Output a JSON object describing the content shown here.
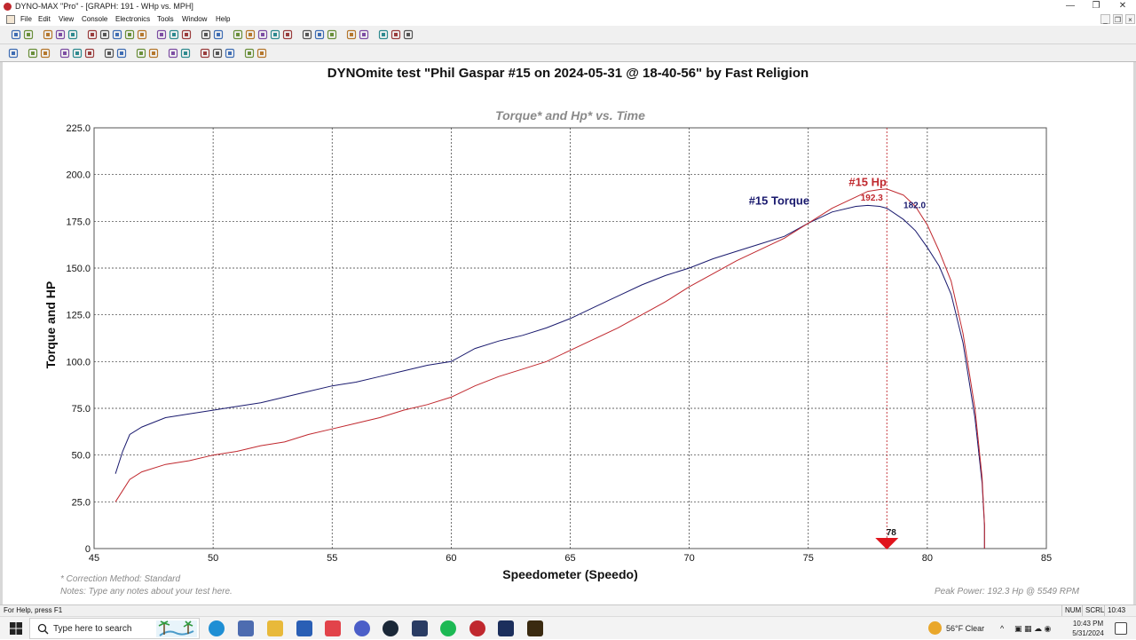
{
  "window": {
    "title": "DYNO-MAX \"Pro\" - [GRAPH: 191 - WHp vs. MPH]",
    "controls": {
      "minimize": "—",
      "maximize": "❐",
      "close": "✕"
    },
    "mdi_controls": {
      "minimize": "_",
      "restore": "❐",
      "close": "×"
    }
  },
  "menu": {
    "items": [
      "File",
      "Edit",
      "View",
      "Console",
      "Electronics",
      "Tools",
      "Window",
      "Help"
    ]
  },
  "toolbar1": {
    "icons": [
      "new-icon",
      "open-icon",
      "save-icon",
      "config-icon",
      "tree-icon",
      "binoculars-icon",
      "copy-icon",
      "paste-icon",
      "print-preview-icon",
      "print-icon",
      "page-setup-icon",
      "import-icon",
      "help-icon",
      "whats-this-icon",
      "grid-icon",
      "tools-icon",
      "table-icon",
      "graph-refresh-icon",
      "table-view-icon",
      "spreadsheet-icon",
      "scale-icon",
      "wave-icon",
      "chart-icon",
      "options-icon",
      "hammer-icon",
      "balloon-icon",
      "settings-icon",
      "gear-icon"
    ]
  },
  "toolbar2": {
    "icons": [
      "pan-icon",
      "cursor-down-icon",
      "cursor-line-icon",
      "zoom-box-icon",
      "zoom-icon",
      "hand-icon",
      "scale-up-icon",
      "scale-down-icon",
      "smooth-icon",
      "overlay-icon",
      "prev-run-icon",
      "next-run-icon",
      "legend-icon",
      "font-icon",
      "color-icon",
      "export-icon",
      "print-graph-icon"
    ]
  },
  "chart_data": {
    "type": "line",
    "title": "DYNOmite test \"Phil Gaspar #15 on 2024-05-31 @ 18-40-56\" by Fast Religion",
    "subtitle": "Torque* and Hp* vs. Time",
    "xlabel": "Speedometer (Speedo)",
    "ylabel": "Torque and HP",
    "xlim": [
      45,
      85
    ],
    "ylim": [
      0,
      225
    ],
    "x_ticks": [
      "45",
      "50",
      "55",
      "60",
      "65",
      "70",
      "75",
      "80",
      "85"
    ],
    "y_ticks": [
      "0",
      "25.0",
      "50.0",
      "75.0",
      "100.0",
      "125.0",
      "150.0",
      "175.0",
      "200.0",
      "225.0"
    ],
    "grid": true,
    "series": [
      {
        "name": "#15 Torque",
        "color": "#1a1a6e",
        "peak_label": "182.0",
        "points": [
          [
            45.9,
            40
          ],
          [
            46.2,
            52
          ],
          [
            46.5,
            61
          ],
          [
            47.0,
            65
          ],
          [
            48.0,
            70
          ],
          [
            49.0,
            72
          ],
          [
            50.0,
            74
          ],
          [
            51.0,
            76
          ],
          [
            52.0,
            78
          ],
          [
            53.0,
            81
          ],
          [
            54.0,
            84
          ],
          [
            55.0,
            87
          ],
          [
            56.0,
            89
          ],
          [
            57.0,
            92
          ],
          [
            58.0,
            95
          ],
          [
            59.0,
            98
          ],
          [
            60.0,
            100
          ],
          [
            61.0,
            107
          ],
          [
            62.0,
            111
          ],
          [
            63.0,
            114
          ],
          [
            64.0,
            118
          ],
          [
            65.0,
            123
          ],
          [
            66.0,
            129
          ],
          [
            67.0,
            135
          ],
          [
            68.0,
            141
          ],
          [
            69.0,
            146
          ],
          [
            70.0,
            150
          ],
          [
            71.0,
            155
          ],
          [
            72.0,
            159
          ],
          [
            73.0,
            163
          ],
          [
            74.0,
            167
          ],
          [
            75.0,
            174
          ],
          [
            76.0,
            180
          ],
          [
            77.0,
            183
          ],
          [
            77.5,
            183.5
          ],
          [
            78.0,
            183
          ],
          [
            78.3,
            182
          ],
          [
            79.0,
            176
          ],
          [
            79.5,
            170
          ],
          [
            80.0,
            161
          ],
          [
            80.5,
            151
          ],
          [
            81.0,
            136
          ],
          [
            81.5,
            110
          ],
          [
            82.0,
            70
          ],
          [
            82.3,
            35
          ],
          [
            82.4,
            12
          ],
          [
            82.4,
            0
          ]
        ]
      },
      {
        "name": "#15 Hp",
        "color": "#c0282e",
        "peak_label": "192.3",
        "points": [
          [
            45.9,
            25
          ],
          [
            46.2,
            31
          ],
          [
            46.5,
            37
          ],
          [
            47.0,
            41
          ],
          [
            48.0,
            45
          ],
          [
            49.0,
            47
          ],
          [
            50.0,
            50
          ],
          [
            51.0,
            52
          ],
          [
            52.0,
            55
          ],
          [
            53.0,
            57
          ],
          [
            54.0,
            61
          ],
          [
            55.0,
            64
          ],
          [
            56.0,
            67
          ],
          [
            57.0,
            70
          ],
          [
            58.0,
            74
          ],
          [
            59.0,
            77
          ],
          [
            60.0,
            81
          ],
          [
            61.0,
            87
          ],
          [
            62.0,
            92
          ],
          [
            63.0,
            96
          ],
          [
            64.0,
            100
          ],
          [
            65.0,
            106
          ],
          [
            66.0,
            112
          ],
          [
            67.0,
            118
          ],
          [
            68.0,
            125
          ],
          [
            69.0,
            132
          ],
          [
            70.0,
            140
          ],
          [
            71.0,
            147
          ],
          [
            72.0,
            154
          ],
          [
            73.0,
            160
          ],
          [
            74.0,
            166
          ],
          [
            75.0,
            174
          ],
          [
            76.0,
            182
          ],
          [
            77.0,
            188
          ],
          [
            77.5,
            191
          ],
          [
            78.0,
            192
          ],
          [
            78.3,
            192.3
          ],
          [
            79.0,
            189
          ],
          [
            79.5,
            183
          ],
          [
            80.0,
            173
          ],
          [
            80.5,
            159
          ],
          [
            81.0,
            143
          ],
          [
            81.5,
            115
          ],
          [
            82.0,
            75
          ],
          [
            82.3,
            38
          ],
          [
            82.4,
            13
          ],
          [
            82.4,
            0
          ]
        ]
      }
    ],
    "cursor": {
      "x": 78.3,
      "label": "78"
    }
  },
  "footer": {
    "correction": "* Correction Method: Standard",
    "notes": "Notes: Type any notes about your test here.",
    "peak_power": "Peak Power: 192.3 Hp @ 5549 RPM"
  },
  "statusbar": {
    "help": "For Help, press F1",
    "num": "NUM",
    "scrl": "SCRL",
    "time": "10:43 PM"
  },
  "taskbar": {
    "search_placeholder": "Type here to search",
    "weather": "56°F  Clear",
    "clock_time": "10:43 PM",
    "clock_date": "5/31/2024"
  }
}
